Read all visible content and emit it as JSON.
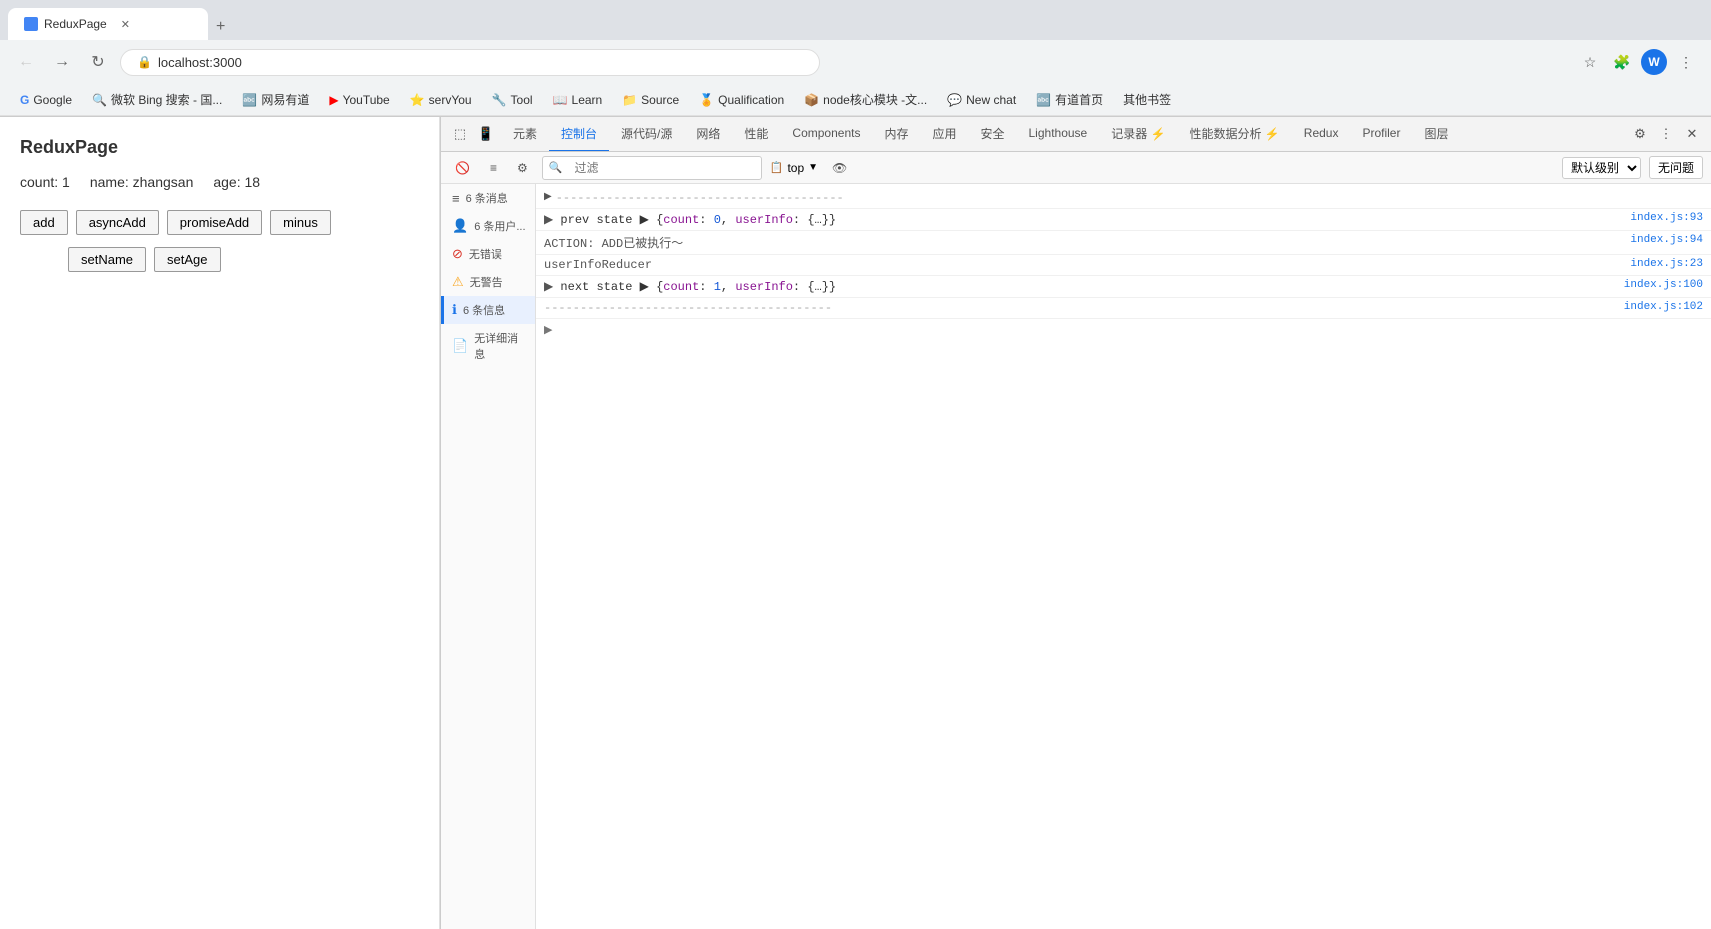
{
  "browser": {
    "url": "localhost:3000",
    "tab_title": "ReduxPage"
  },
  "bookmarks": [
    {
      "label": "Google",
      "icon": "G"
    },
    {
      "label": "微软 Bing 搜索 - 国...",
      "icon": "B"
    },
    {
      "label": "网易有道",
      "icon": "🔤"
    },
    {
      "label": "YouTube",
      "icon": "▶"
    },
    {
      "label": "servYou",
      "icon": "⭐"
    },
    {
      "label": "Tool",
      "icon": "🔧"
    },
    {
      "label": "Learn",
      "icon": "📖"
    },
    {
      "label": "Source",
      "icon": "📁"
    },
    {
      "label": "Qualification",
      "icon": "🏅"
    },
    {
      "label": "node核心模块 -文...",
      "icon": "📦"
    },
    {
      "label": "New chat",
      "icon": "💬"
    },
    {
      "label": "有道首页",
      "icon": "🔤"
    }
  ],
  "app": {
    "title": "ReduxPage",
    "count_label": "count:",
    "count_value": "1",
    "name_label": "name:",
    "name_value": "zhangsan",
    "age_label": "age:",
    "age_value": "18",
    "buttons_row1": [
      "add",
      "asyncAdd",
      "promiseAdd",
      "minus"
    ],
    "buttons_row2": [
      "setName",
      "setAge"
    ]
  },
  "devtools": {
    "tabs": [
      {
        "label": "元素",
        "active": false
      },
      {
        "label": "控制台",
        "active": true
      },
      {
        "label": "源代码/源",
        "active": false
      },
      {
        "label": "网络",
        "active": false
      },
      {
        "label": "性能",
        "active": false
      },
      {
        "label": "Components",
        "active": false
      },
      {
        "label": "内存",
        "active": false
      },
      {
        "label": "应用",
        "active": false
      },
      {
        "label": "安全",
        "active": false
      },
      {
        "label": "Lighthouse",
        "active": false
      },
      {
        "label": "记录器 ⚡",
        "active": false
      },
      {
        "label": "性能数据分析 ⚡",
        "active": false
      },
      {
        "label": "Redux",
        "active": false
      },
      {
        "label": "Profiler",
        "active": false
      },
      {
        "label": "图层",
        "active": false
      }
    ],
    "toolbar": {
      "clear_label": "🚫",
      "filter_placeholder": "过滤",
      "scope_label": "top",
      "eye_label": "👁",
      "issues_label": "无问题",
      "level_label": "默认级别 ▾"
    },
    "sidebar": {
      "items": [
        {
          "icon": "all",
          "count": "6 条",
          "label": "消息",
          "active": false
        },
        {
          "icon": "user",
          "count": "6 条用户...",
          "label": "",
          "active": false
        },
        {
          "icon": "error",
          "count": "无错误",
          "label": "",
          "active": false
        },
        {
          "icon": "warn",
          "count": "无警告",
          "label": "",
          "active": false
        },
        {
          "icon": "info",
          "count": "6 条信息",
          "label": "",
          "active": true
        },
        {
          "icon": "verbose",
          "count": "无详细消息",
          "label": "",
          "active": false
        }
      ]
    },
    "console_lines": [
      {
        "type": "separator",
        "content": "----------------------------------------",
        "source": ""
      },
      {
        "type": "state",
        "content": "prev state ▶ {count: 0, userInfo: {…}}",
        "source": "index.js:93"
      },
      {
        "type": "action",
        "content": "ACTION: ADD已被执行～",
        "source": "index.js:94"
      },
      {
        "type": "reducer",
        "content": "userInfoReducer",
        "source": "index.js:23"
      },
      {
        "type": "state",
        "content": "next state ▶ {count: 1, userInfo: {…}}",
        "source": "index.js:100"
      },
      {
        "type": "separator",
        "content": "----------------------------------------",
        "source": "index.js:102"
      }
    ]
  }
}
